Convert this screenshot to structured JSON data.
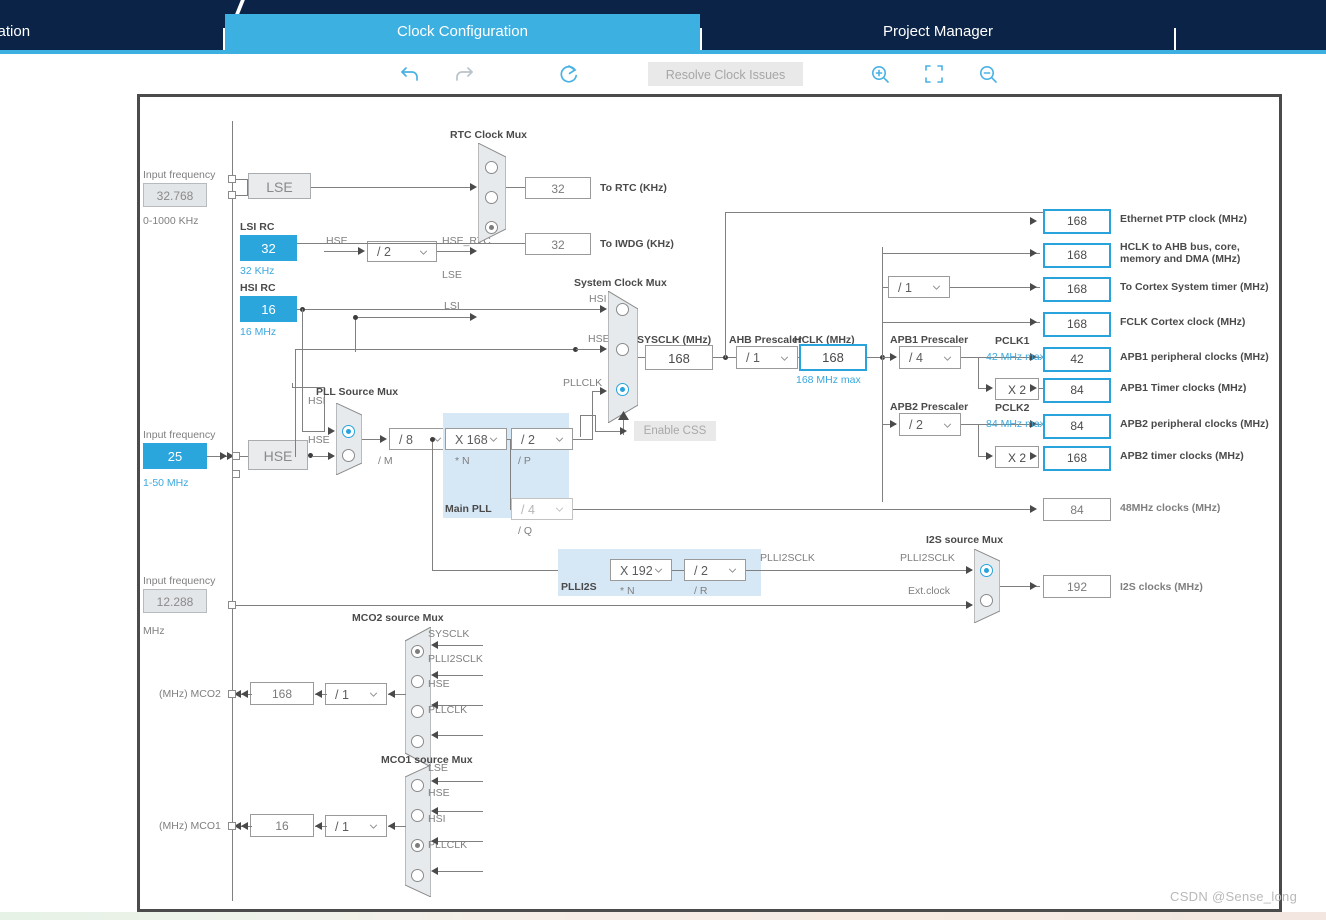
{
  "tabs": [
    {
      "label": "nfiguration",
      "selected": false
    },
    {
      "label": "Clock Configuration",
      "selected": true
    },
    {
      "label": "Project Manager",
      "selected": false
    },
    {
      "label": "",
      "selected": false
    }
  ],
  "toolbar": {
    "undo": "undo-icon",
    "redo": "redo-icon",
    "reset": "reset-icon",
    "resolve_label": "Resolve Clock Issues",
    "zoom_in": "zoom-in-icon",
    "fit": "fit-screen-icon",
    "zoom_out": "zoom-out-icon"
  },
  "diagram": {
    "lse": {
      "input_frequency_label": "Input frequency",
      "input_frequency_value": "32.768",
      "range": "0-1000 KHz",
      "name": "LSE"
    },
    "hse_rtc_divider": "/ 2",
    "hse_rtc_signal": "HSE",
    "hse_rtc_out": "HSE_RTC",
    "rtc_mux": {
      "title": "RTC Clock Mux",
      "inputs": [
        "HSE_RTC",
        "LSE",
        "LSI"
      ],
      "selected": 2
    },
    "to_rtc": {
      "value": "32",
      "label": "To RTC (KHz)"
    },
    "to_iwdg": {
      "value": "32",
      "label": "To IWDG (KHz)"
    },
    "lsi": {
      "title": "LSI RC",
      "value": "32",
      "unit": "32 KHz"
    },
    "hsi": {
      "title": "HSI RC",
      "value": "16",
      "unit": "16 MHz"
    },
    "hse": {
      "input_frequency_label": "Input frequency",
      "input_frequency_value": "25",
      "range": "1-50 MHz",
      "name": "HSE"
    },
    "pll_source_mux": {
      "title": "PLL Source Mux",
      "inputs": [
        "HSI",
        "HSE"
      ],
      "selected": 0
    },
    "pll_m": {
      "value": "/ 8",
      "label": "/ M"
    },
    "main_pll": {
      "title": "Main PLL",
      "n": {
        "value": "X 168",
        "label": "* N"
      },
      "p": {
        "value": "/ 2",
        "label": "/ P"
      },
      "q": {
        "value": "/ 4",
        "label": "/ Q"
      }
    },
    "system_clock_mux": {
      "title": "System Clock Mux",
      "inputs": [
        "HSI",
        "HSE",
        "PLLCLK"
      ],
      "selected": 2
    },
    "enable_css": "Enable CSS",
    "sysclk": {
      "label": "SYSCLK (MHz)",
      "value": "168"
    },
    "ahb_prescaler": {
      "label": "AHB Prescaler",
      "value": "/ 1"
    },
    "hclk": {
      "label": "HCLK (MHz)",
      "value": "168",
      "max": "168 MHz max"
    },
    "cortex_prescaler": {
      "value": "/ 1"
    },
    "apb1_prescaler": {
      "label": "APB1 Prescaler",
      "value": "/ 4"
    },
    "pclk1": {
      "label": "PCLK1",
      "max": "42 MHz max"
    },
    "apb1_timer_mul": "X 2",
    "apb2_prescaler": {
      "label": "APB2 Prescaler",
      "value": "/ 2"
    },
    "pclk2": {
      "label": "PCLK2",
      "max": "84 MHz max"
    },
    "apb2_timer_mul": "X 2",
    "outputs": [
      {
        "value": "168",
        "label": "Ethernet PTP clock (MHz)",
        "active": true
      },
      {
        "value": "168",
        "label": "HCLK to AHB bus, core,\nmemory and DMA (MHz)",
        "active": true
      },
      {
        "value": "168",
        "label": "To Cortex System timer (MHz)",
        "active": true
      },
      {
        "value": "168",
        "label": "FCLK Cortex clock (MHz)",
        "active": true
      },
      {
        "value": "42",
        "label": "APB1 peripheral clocks (MHz)",
        "active": true
      },
      {
        "value": "84",
        "label": "APB1 Timer clocks (MHz)",
        "active": true
      },
      {
        "value": "84",
        "label": "APB2 peripheral clocks (MHz)",
        "active": true
      },
      {
        "value": "168",
        "label": "APB2 timer clocks (MHz)",
        "active": true
      },
      {
        "value": "84",
        "label": "48MHz clocks (MHz)",
        "active": false
      }
    ],
    "out_hclk_line1": "HCLK to AHB bus, core,",
    "out_hclk_line2": "memory and DMA (MHz)",
    "plli2s": {
      "title": "PLLI2S",
      "n": {
        "value": "X 192",
        "label": "* N"
      },
      "r": {
        "value": "/ 2",
        "label": "/ R"
      },
      "out_signal": "PLLI2SCLK"
    },
    "i2s_mux": {
      "title": "I2S source Mux",
      "inputs": [
        "PLLI2SCLK",
        "Ext.clock"
      ],
      "selected": 0
    },
    "i2s_out": {
      "value": "192",
      "label": "I2S clocks (MHz)"
    },
    "mco2": {
      "title": "MCO2 source Mux",
      "inputs": [
        "SYSCLK",
        "PLLI2SCLK",
        "HSE",
        "PLLCLK"
      ],
      "selected": 0,
      "divider": "/ 1",
      "value": "168",
      "pin_label": "(MHz) MCO2"
    },
    "mco1": {
      "title": "MCO1 source Mux",
      "inputs": [
        "LSE",
        "HSE",
        "HSI",
        "PLLCLK"
      ],
      "selected": 2,
      "divider": "/ 1",
      "value": "16",
      "pin_label": "(MHz) MCO1"
    },
    "i2s_input": {
      "input_frequency_label": "Input frequency",
      "input_frequency_value": "12.288",
      "unit": "MHz"
    }
  },
  "watermark": "CSDN @Sense_long",
  "colors": {
    "accent": "#29a3dc",
    "header_dark": "#0b2346",
    "tab_selected": "#3cb0e0",
    "pll_region": "#d6e7f5"
  }
}
